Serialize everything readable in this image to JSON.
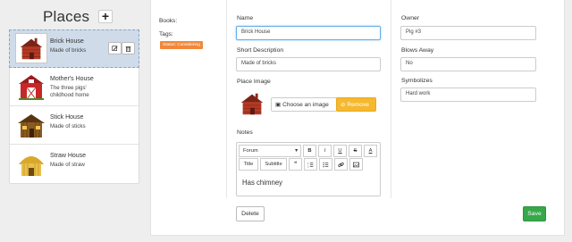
{
  "sidebar": {
    "title": "Places",
    "add_label": "+",
    "items": [
      {
        "name": "Brick House",
        "desc": "Made of bricks",
        "edit_icon": "edit-icon",
        "delete_icon": "trash-icon"
      },
      {
        "name": "Mother's House",
        "desc": "The three pigs' childhood home"
      },
      {
        "name": "Stick House",
        "desc": "Made of sticks"
      },
      {
        "name": "Straw House",
        "desc": "Made of straw"
      }
    ]
  },
  "meta": {
    "books_label": "Books:",
    "tags_label": "Tags:",
    "tag": "Status: Considering"
  },
  "form": {
    "name_label": "Name",
    "name_value": "Brick House",
    "short_desc_label": "Short Description",
    "short_desc_value": "Made of bricks",
    "place_image_label": "Place Image",
    "choose_image_label": "Choose an image",
    "remove_label": "Remove",
    "notes_label": "Notes",
    "notes_value": "Has chimney",
    "owner_label": "Owner",
    "owner_value": "Pig #3",
    "blows_away_label": "Blows Away",
    "blows_away_value": "No",
    "symbolizes_label": "Symbolizes",
    "symbolizes_value": "Hard work"
  },
  "toolbar": {
    "font_select": "Forum",
    "bold": "B",
    "italic": "I",
    "underline": "U",
    "strike": "S",
    "color": "A",
    "title": "Title",
    "subtitle": "Subtitle",
    "quote": "❝",
    "ordered_list_icon": "ordered-list-icon",
    "bullet_list_icon": "bullet-list-icon",
    "link_icon": "link-icon",
    "image_icon": "image-icon"
  },
  "actions": {
    "delete_label": "Delete",
    "save_label": "Save"
  },
  "colors": {
    "tag_bg": "#f0883a",
    "remove_bg": "#f5b82e",
    "save_bg": "#36a84a",
    "active_item_bg": "#cfdbe9"
  }
}
